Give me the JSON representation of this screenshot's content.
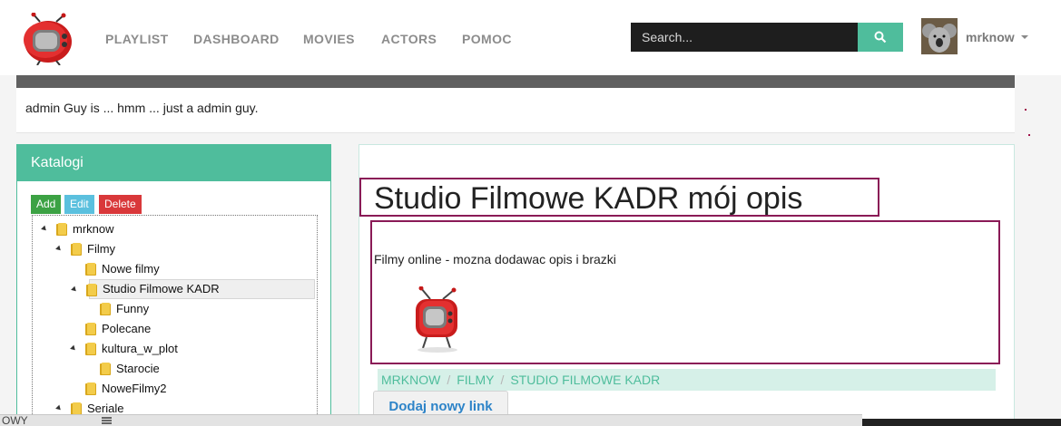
{
  "navbar": {
    "links": [
      "PLAYLIST",
      "DASHBOARD",
      "MOVIES",
      "ACTORS",
      "POMOC"
    ],
    "search_placeholder": "Search...",
    "user_name": "mrknow"
  },
  "profile": {
    "about_text": "admin Guy is ... hmm ... just a admin guy."
  },
  "sidebar": {
    "title": "Katalogi",
    "buttons": {
      "add": "Add",
      "edit": "Edit",
      "delete": "Delete"
    },
    "tree": [
      {
        "label": "mrknow",
        "level": 0,
        "expanded": true,
        "selected": false
      },
      {
        "label": "Filmy",
        "level": 1,
        "expanded": true,
        "selected": false
      },
      {
        "label": "Nowe filmy",
        "level": 2,
        "expanded": false,
        "selected": false
      },
      {
        "label": "Studio Filmowe KADR",
        "level": 2,
        "expanded": true,
        "selected": true
      },
      {
        "label": "Funny",
        "level": 3,
        "expanded": false,
        "selected": false
      },
      {
        "label": "Polecane",
        "level": 2,
        "expanded": false,
        "selected": false
      },
      {
        "label": "kultura_w_plot",
        "level": 2,
        "expanded": true,
        "selected": false
      },
      {
        "label": "Starocie",
        "level": 3,
        "expanded": false,
        "selected": false
      },
      {
        "label": "NoweFilmy2",
        "level": 2,
        "expanded": false,
        "selected": false
      },
      {
        "label": "Seriale",
        "level": 1,
        "expanded": true,
        "selected": false
      }
    ]
  },
  "main": {
    "title": "Studio Filmowe KADR mój opis",
    "description": "Filmy online - mozna dodawac opis i brazki",
    "breadcrumb": [
      "MRKNOW",
      "FILMY",
      "STUDIO FILMOWE KADR"
    ],
    "add_link_label": "Dodaj nowy link"
  },
  "footer": {
    "left_text": "OWY"
  },
  "colors": {
    "accent": "#4fbd9c",
    "nav_text": "#8c8c8c",
    "outline": "#8a1a56",
    "add": "#3ca244",
    "edit": "#5bc0de",
    "delete": "#d9383a",
    "link": "#2e84c8"
  }
}
